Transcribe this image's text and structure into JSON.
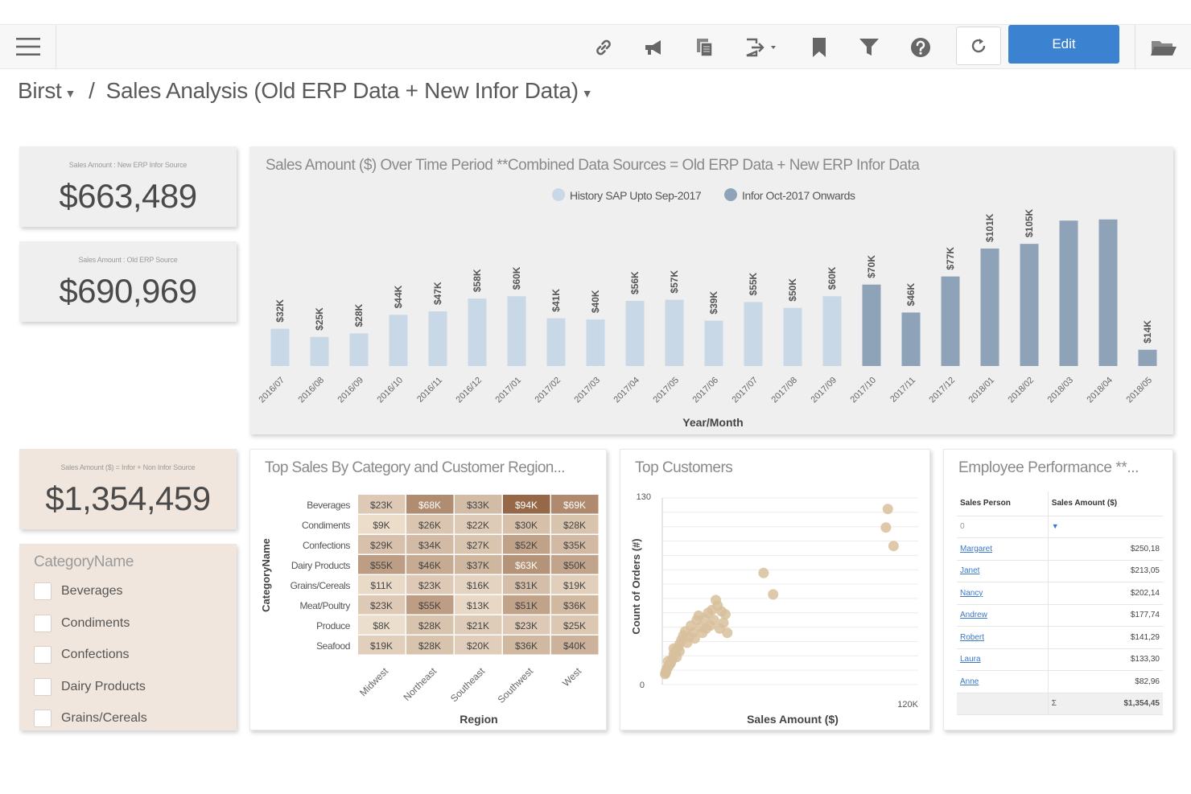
{
  "toolbar": {
    "edit_label": "Edit",
    "icons": [
      "menu-icon",
      "link-icon",
      "announce-icon",
      "copy-icon",
      "export-icon",
      "bookmark-icon",
      "filter-icon",
      "help-icon",
      "refresh-icon",
      "folder-icon"
    ]
  },
  "breadcrumb": {
    "root": "Birst",
    "separator": "/",
    "page": "Sales Analysis (Old ERP Data + New Infor Data)"
  },
  "kpis": [
    {
      "label": "Sales Amount : New ERP Infor Source",
      "value": "$663,489"
    },
    {
      "label": "Sales Amount : Old ERP Source",
      "value": "$690,969"
    },
    {
      "label": "Sales Amount ($) = Infor + Non Infor Source",
      "value": "$1,354,459"
    }
  ],
  "category_filter": {
    "title": "CategoryName",
    "items": [
      "Beverages",
      "Condiments",
      "Confections",
      "Dairy Products",
      "Grains/Cereals"
    ]
  },
  "colors": {
    "history_bar": "#c9d8e6",
    "infor_bar": "#8ea3b8",
    "accent": "#3b82d0",
    "link": "#3a78c7",
    "scatter_point": "#d8bf9c"
  },
  "chart_data": [
    {
      "type": "bar",
      "title": "Sales Amount ($) Over Time Period **Combined Data Sources = Old ERP Data + New ERP Infor Data",
      "xlabel": "Year/Month",
      "ylabel": "",
      "legend_position": "top",
      "categories": [
        "2016/07",
        "2016/08",
        "2016/09",
        "2016/10",
        "2016/11",
        "2016/12",
        "2017/01",
        "2017/02",
        "2017/03",
        "2017/04",
        "2017/05",
        "2017/06",
        "2017/07",
        "2017/08",
        "2017/09",
        "2017/10",
        "2017/11",
        "2017/12",
        "2018/01",
        "2018/02",
        "2018/03",
        "2018/04",
        "2018/05"
      ],
      "series": [
        {
          "name": "History SAP Upto Sep-2017",
          "values": [
            32,
            25,
            28,
            44,
            47,
            58,
            60,
            41,
            40,
            56,
            57,
            39,
            55,
            50,
            60,
            null,
            null,
            null,
            null,
            null,
            null,
            null,
            null
          ]
        },
        {
          "name": "Infor Oct-2017 Onwards",
          "values": [
            null,
            null,
            null,
            null,
            null,
            null,
            null,
            null,
            null,
            null,
            null,
            null,
            null,
            null,
            null,
            70,
            46,
            77,
            101,
            105,
            125,
            126,
            14
          ]
        }
      ],
      "labels": [
        "$32K",
        "$25K",
        "$28K",
        "$44K",
        "$47K",
        "$58K",
        "$60K",
        "$41K",
        "$40K",
        "$56K",
        "$57K",
        "$39K",
        "$55K",
        "$50K",
        "$60K",
        "$70K",
        "$46K",
        "$77K",
        "$101K",
        "$105K",
        "",
        "",
        "$14K"
      ],
      "units": "K$",
      "ylim": [
        0,
        130
      ]
    },
    {
      "type": "heatmap",
      "title": "Top Sales By Category and Customer Region...",
      "xlabel": "Region",
      "ylabel": "CategoryName",
      "columns": [
        "Midwest",
        "Northeast",
        "Southeast",
        "Southwest",
        "West"
      ],
      "rows": [
        "Beverages",
        "Condiments",
        "Confections",
        "Dairy Products",
        "Grains/Cereals",
        "Meat/Poultry",
        "Produce",
        "Seafood"
      ],
      "values": [
        [
          23,
          68,
          33,
          94,
          69
        ],
        [
          9,
          26,
          22,
          30,
          28
        ],
        [
          29,
          34,
          27,
          52,
          35
        ],
        [
          55,
          46,
          37,
          63,
          50
        ],
        [
          11,
          23,
          16,
          31,
          19
        ],
        [
          23,
          55,
          13,
          51,
          36
        ],
        [
          8,
          28,
          21,
          23,
          25
        ],
        [
          19,
          28,
          20,
          36,
          40
        ]
      ],
      "cell_labels": [
        [
          "$23K",
          "$68K",
          "$33K",
          "$94K",
          "$69K"
        ],
        [
          "$9K",
          "$26K",
          "$22K",
          "$30K",
          "$28K"
        ],
        [
          "$29K",
          "$34K",
          "$27K",
          "$52K",
          "$35K"
        ],
        [
          "$55K",
          "$46K",
          "$37K",
          "$63K",
          "$50K"
        ],
        [
          "$11K",
          "$23K",
          "$16K",
          "$31K",
          "$19K"
        ],
        [
          "$23K",
          "$55K",
          "$13K",
          "$51K",
          "$36K"
        ],
        [
          "$8K",
          "$28K",
          "$21K",
          "$23K",
          "$25K"
        ],
        [
          "$19K",
          "$28K",
          "$20K",
          "$36K",
          "$40K"
        ]
      ]
    },
    {
      "type": "scatter",
      "title": "Top Customers",
      "xlabel": "Sales Amount ($)",
      "ylabel": "Count of Orders (#)",
      "xlim": [
        0,
        120000
      ],
      "ylim": [
        0,
        130
      ],
      "x_tick_labels": [
        "120K"
      ],
      "y_tick_labels": [
        "0",
        "130"
      ],
      "points": [
        [
          118000,
          120
        ],
        [
          117000,
          107
        ],
        [
          121000,
          94
        ],
        [
          53000,
          75
        ],
        [
          58000,
          60
        ],
        [
          28000,
          56
        ],
        [
          29000,
          52
        ],
        [
          31000,
          48
        ],
        [
          26000,
          49
        ],
        [
          32000,
          40
        ],
        [
          33000,
          46
        ],
        [
          24000,
          47
        ],
        [
          22000,
          43
        ],
        [
          18000,
          42
        ],
        [
          25000,
          38
        ],
        [
          20000,
          37
        ],
        [
          16000,
          33
        ],
        [
          14000,
          30
        ],
        [
          12000,
          34
        ],
        [
          10000,
          28
        ],
        [
          9000,
          25
        ],
        [
          8000,
          22
        ],
        [
          7000,
          20
        ],
        [
          6000,
          18
        ],
        [
          5500,
          15
        ],
        [
          5000,
          14
        ],
        [
          4500,
          12
        ],
        [
          4000,
          11
        ],
        [
          3500,
          10
        ],
        [
          3000,
          9
        ],
        [
          2500,
          8
        ],
        [
          2200,
          7
        ],
        [
          2000,
          6
        ],
        [
          1800,
          5
        ],
        [
          1500,
          4
        ],
        [
          3000,
          13
        ],
        [
          6000,
          22
        ],
        [
          11000,
          31
        ],
        [
          15000,
          38
        ],
        [
          19000,
          45
        ],
        [
          27000,
          42
        ],
        [
          21000,
          33
        ],
        [
          13000,
          26
        ],
        [
          9000,
          20
        ],
        [
          7500,
          16
        ],
        [
          17000,
          29
        ],
        [
          23000,
          36
        ],
        [
          30000,
          36
        ],
        [
          34000,
          33
        ]
      ]
    }
  ],
  "employee_table": {
    "title": "Employee Performance **...",
    "headers": [
      "Sales Person",
      "Sales Amount ($)"
    ],
    "filter_placeholder": "0",
    "rows": [
      {
        "name": "Margaret",
        "amount": "$250,18"
      },
      {
        "name": "Janet",
        "amount": "$213,05"
      },
      {
        "name": "Nancy",
        "amount": "$202,14"
      },
      {
        "name": "Andrew",
        "amount": "$177,74"
      },
      {
        "name": "Robert",
        "amount": "$141,29"
      },
      {
        "name": "Laura",
        "amount": "$133,30"
      },
      {
        "name": "Anne",
        "amount": "$82,96"
      }
    ],
    "total_symbol": "Σ",
    "total": "$1,354,45"
  }
}
